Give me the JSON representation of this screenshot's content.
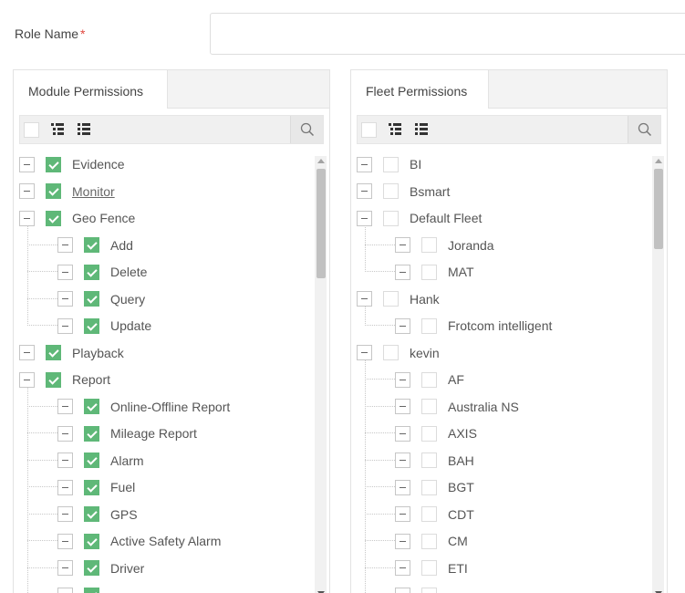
{
  "role": {
    "label": "Role Name",
    "required_mark": "*",
    "value": "",
    "placeholder": ""
  },
  "module_panel": {
    "tab": "Module Permissions",
    "nodes": [
      {
        "label": "Evidence",
        "level": 0,
        "checked": true
      },
      {
        "label": "Monitor",
        "level": 0,
        "checked": true,
        "link": true
      },
      {
        "label": "Geo Fence",
        "level": 0,
        "checked": true
      },
      {
        "label": "Add",
        "level": 1,
        "checked": true
      },
      {
        "label": "Delete",
        "level": 1,
        "checked": true
      },
      {
        "label": "Query",
        "level": 1,
        "checked": true
      },
      {
        "label": "Update",
        "level": 1,
        "checked": true
      },
      {
        "label": "Playback",
        "level": 0,
        "checked": true
      },
      {
        "label": "Report",
        "level": 0,
        "checked": true
      },
      {
        "label": "Online-Offline Report",
        "level": 1,
        "checked": true
      },
      {
        "label": "Mileage Report",
        "level": 1,
        "checked": true
      },
      {
        "label": "Alarm",
        "level": 1,
        "checked": true
      },
      {
        "label": "Fuel",
        "level": 1,
        "checked": true
      },
      {
        "label": "GPS",
        "level": 1,
        "checked": true
      },
      {
        "label": "Active Safety Alarm",
        "level": 1,
        "checked": true
      },
      {
        "label": "Driver",
        "level": 1,
        "checked": true
      },
      {
        "label": "",
        "level": 1,
        "checked": true
      }
    ]
  },
  "fleet_panel": {
    "tab": "Fleet Permissions",
    "nodes": [
      {
        "label": "BI",
        "level": 0,
        "checked": false
      },
      {
        "label": "Bsmart",
        "level": 0,
        "checked": false
      },
      {
        "label": "Default Fleet",
        "level": 0,
        "checked": false
      },
      {
        "label": "Joranda",
        "level": 1,
        "checked": false
      },
      {
        "label": "MAT",
        "level": 1,
        "checked": false
      },
      {
        "label": "Hank",
        "level": 0,
        "checked": false
      },
      {
        "label": "Frotcom intelligent",
        "level": 1,
        "checked": false
      },
      {
        "label": "kevin",
        "level": 0,
        "checked": false
      },
      {
        "label": "AF",
        "level": 1,
        "checked": false
      },
      {
        "label": "Australia NS",
        "level": 1,
        "checked": false
      },
      {
        "label": "AXIS",
        "level": 1,
        "checked": false
      },
      {
        "label": "BAH",
        "level": 1,
        "checked": false
      },
      {
        "label": "BGT",
        "level": 1,
        "checked": false
      },
      {
        "label": "CDT",
        "level": 1,
        "checked": false
      },
      {
        "label": "CM",
        "level": 1,
        "checked": false
      },
      {
        "label": "ETI",
        "level": 1,
        "checked": false
      },
      {
        "label": "",
        "level": 1,
        "checked": false
      }
    ]
  },
  "icons": {
    "select_all": "checkbox-icon",
    "expand_all": "expand-all-icon",
    "collapse_all": "collapse-all-icon",
    "search": "search-icon"
  },
  "colors": {
    "check_green": "#5fb878",
    "required_red": "#e0473e"
  }
}
